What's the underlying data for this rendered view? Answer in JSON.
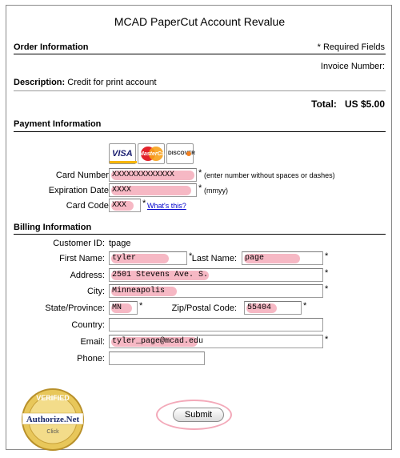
{
  "page": {
    "title": "MCAD PaperCut Account Revalue"
  },
  "order": {
    "heading": "Order Information",
    "required_note": "* Required Fields",
    "invoice_label": "Invoice Number:",
    "description_label": "Description:",
    "description_value": "Credit for print account",
    "total_label": "Total:",
    "total_value": "US $5.00"
  },
  "payment": {
    "heading": "Payment Information",
    "card_logos": [
      "VISA",
      "MasterCard",
      "DISCOVER"
    ],
    "card_number": {
      "label": "Card Number:",
      "value": "XXXXXXXXXXXXX",
      "hint": "(enter number without spaces or dashes)"
    },
    "expiration": {
      "label": "Expiration Date:",
      "value": "XXXX",
      "hint": "(mmyy)"
    },
    "card_code": {
      "label": "Card Code:",
      "value": "XXX",
      "link": "What's this?"
    },
    "asterisk": "*"
  },
  "billing": {
    "heading": "Billing Information",
    "customer_id": {
      "label": "Customer ID:",
      "value": "tpage"
    },
    "first_name": {
      "label": "First Name:",
      "value": "tyler"
    },
    "last_name": {
      "label": "Last Name:",
      "value": "page"
    },
    "address": {
      "label": "Address:",
      "value": "2501 Stevens Ave. S."
    },
    "city": {
      "label": "City:",
      "value": "Minneapolis"
    },
    "state": {
      "label": "State/Province:",
      "value": "MN"
    },
    "zip": {
      "label": "Zip/Postal Code:",
      "value": "55404"
    },
    "country": {
      "label": "Country:",
      "value": ""
    },
    "email": {
      "label": "Email:",
      "value": "tyler_page@mcad.edu"
    },
    "phone": {
      "label": "Phone:",
      "value": ""
    },
    "asterisk": "*"
  },
  "seal": {
    "top": "VERIFIED",
    "brand": "Authorize.Net",
    "sub": "Click"
  },
  "submit_label": "Submit",
  "colors": {
    "highlight": "#f6b8c4",
    "link": "#0000cc",
    "seal_gold": "#d9b13b"
  }
}
